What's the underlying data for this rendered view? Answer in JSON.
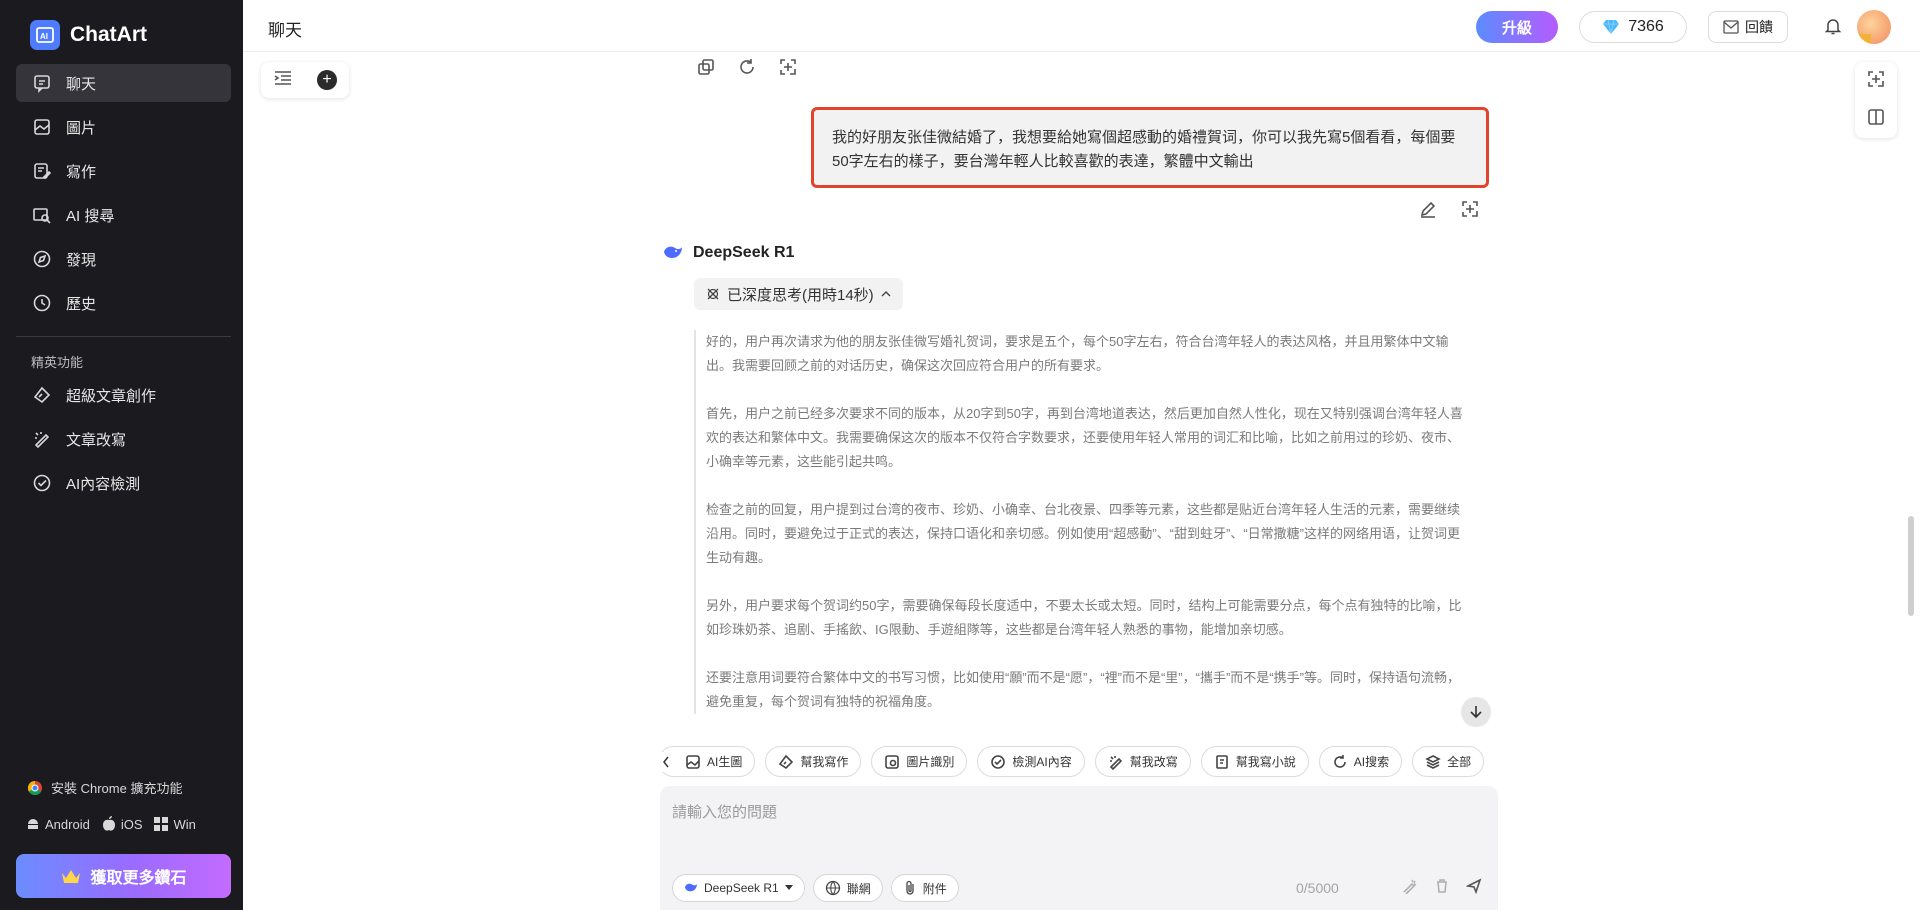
{
  "app": {
    "name": "ChatArt"
  },
  "sidebar": {
    "items": [
      {
        "label": "聊天",
        "icon": "chat-icon"
      },
      {
        "label": "圖片",
        "icon": "image-icon"
      },
      {
        "label": "寫作",
        "icon": "writing-icon"
      },
      {
        "label": "AI 搜尋",
        "icon": "ai-search-icon"
      },
      {
        "label": "發現",
        "icon": "discover-icon"
      },
      {
        "label": "歷史",
        "icon": "history-icon"
      }
    ],
    "section_label": "精英功能",
    "elite_items": [
      {
        "label": "超級文章創作",
        "icon": "article-create-icon"
      },
      {
        "label": "文章改寫",
        "icon": "rewrite-icon"
      },
      {
        "label": "AI內容檢測",
        "icon": "ai-detect-icon"
      }
    ],
    "chrome_ext": "安裝 Chrome 擴充功能",
    "platforms": [
      "Android",
      "iOS",
      "Win"
    ],
    "get_diamonds": "獲取更多鑽石"
  },
  "topbar": {
    "title": "聊天",
    "upgrade": "升級",
    "diamonds": "7366",
    "feedback": "回饋"
  },
  "chat": {
    "user_message": "我的好朋友张佳微結婚了，我想要給她寫個超感動的婚禮賀词，你可以我先寫5個看看，每個要50字左右的樣子，要台灣年輕人比較喜歡的表達，繁體中文輸出",
    "assistant_name": "DeepSeek R1",
    "think_label": "已深度思考(用時14秒)",
    "thinking": [
      "好的，用户再次请求为他的朋友张佳微写婚礼贺词，要求是五个，每个50字左右，符合台湾年轻人的表达风格，并且用繁体中文输出。我需要回顾之前的对话历史，确保这次回应符合用户的所有要求。",
      "首先，用户之前已经多次要求不同的版本，从20字到50字，再到台湾地道表达，然后更加自然人性化，现在又特别强调台湾年轻人喜欢的表达和繁体中文。我需要确保这次的版本不仅符合字数要求，还要使用年轻人常用的词汇和比喻，比如之前用过的珍奶、夜市、小确幸等元素，这些能引起共鸣。",
      "检查之前的回复，用户提到过台湾的夜市、珍奶、小确幸、台北夜景、四季等元素，这些都是贴近台湾年轻人生活的元素，需要继续沿用。同时，要避免过于正式的表达，保持口语化和亲切感。例如使用“超感動”、“甜到蛀牙”、“日常撒糖”这样的网络用语，让贺词更生动有趣。",
      "另外，用户要求每个贺词约50字，需要确保每段长度适中，不要太长或太短。同时，结构上可能需要分点，每个点有独特的比喻，比如珍珠奶茶、追剧、手搖飲、IG限動、手遊組隊等，这些都是台湾年轻人熟悉的事物，能增加亲切感。",
      "还要注意用词要符合繁体中文的书写习惯，比如使用“願”而不是“愿”，“裡”而不是“里”，“攜手”而不是“携手”等。同时，保持语句流畅，避免重复，每个贺词有独特的祝福角度。"
    ]
  },
  "quick_actions": [
    "AI生圖",
    "幫我寫作",
    "圖片識別",
    "檢測AI內容",
    "幫我改寫",
    "幫我寫小說",
    "AI搜索",
    "全部"
  ],
  "input": {
    "placeholder": "請輸入您的問題",
    "model": "DeepSeek R1",
    "web": "聯網",
    "attach": "附件",
    "count": "0/5000"
  },
  "colors": {
    "accent": "#4f7cff",
    "highlight_border": "#e0442d",
    "sidebar_bg": "#1b1b1f"
  }
}
